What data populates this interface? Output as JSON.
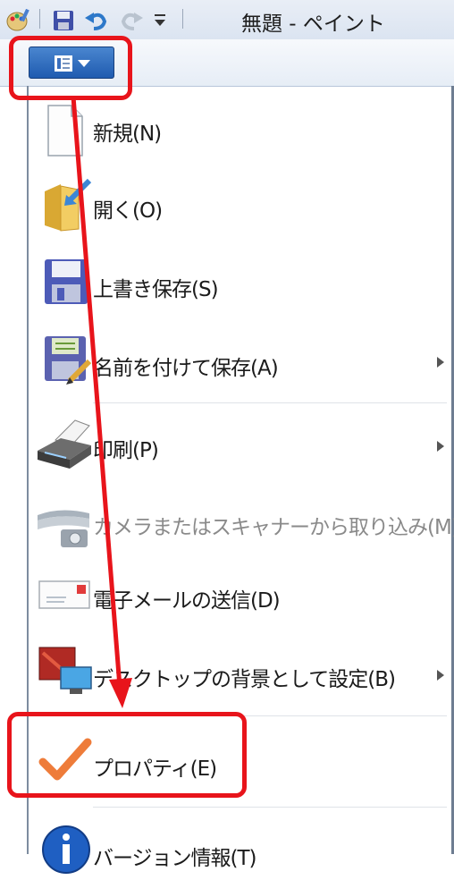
{
  "window": {
    "title": "無題 - ペイント"
  },
  "quick_access": {
    "icons": [
      "paint-app-icon",
      "save-icon",
      "undo-icon",
      "redo-icon",
      "customize-dropdown-icon"
    ]
  },
  "app_menu_button": {
    "icon": "document-list-icon",
    "caret": "chevron-down-icon"
  },
  "menu": {
    "items": [
      {
        "label": "新規(N)",
        "icon": "blank-page-icon",
        "submenu": false,
        "enabled": true
      },
      {
        "label": "開く(O)",
        "icon": "open-folder-icon",
        "submenu": false,
        "enabled": true
      },
      {
        "label": "上書き保存(S)",
        "icon": "floppy-disk-icon",
        "submenu": false,
        "enabled": true
      },
      {
        "label": "名前を付けて保存(A)",
        "icon": "save-as-icon",
        "submenu": true,
        "enabled": true
      },
      {
        "label": "印刷(P)",
        "icon": "printer-icon",
        "submenu": true,
        "enabled": true
      },
      {
        "label": "カメラまたはスキャナーから取り込み(M)",
        "icon": "scanner-icon",
        "submenu": false,
        "enabled": false
      },
      {
        "label": "電子メールの送信(D)",
        "icon": "envelope-icon",
        "submenu": false,
        "enabled": true
      },
      {
        "label": "デスクトップの背景として設定(B)",
        "icon": "desktop-background-icon",
        "submenu": true,
        "enabled": true
      },
      {
        "label": "プロパティ(E)",
        "icon": "checkmark-icon",
        "submenu": false,
        "enabled": true
      },
      {
        "label": "バージョン情報(T)",
        "icon": "info-icon",
        "submenu": false,
        "enabled": true
      }
    ]
  },
  "colors": {
    "annotation_red": "#e8141b",
    "app_button_blue": "#2f6bbd"
  }
}
